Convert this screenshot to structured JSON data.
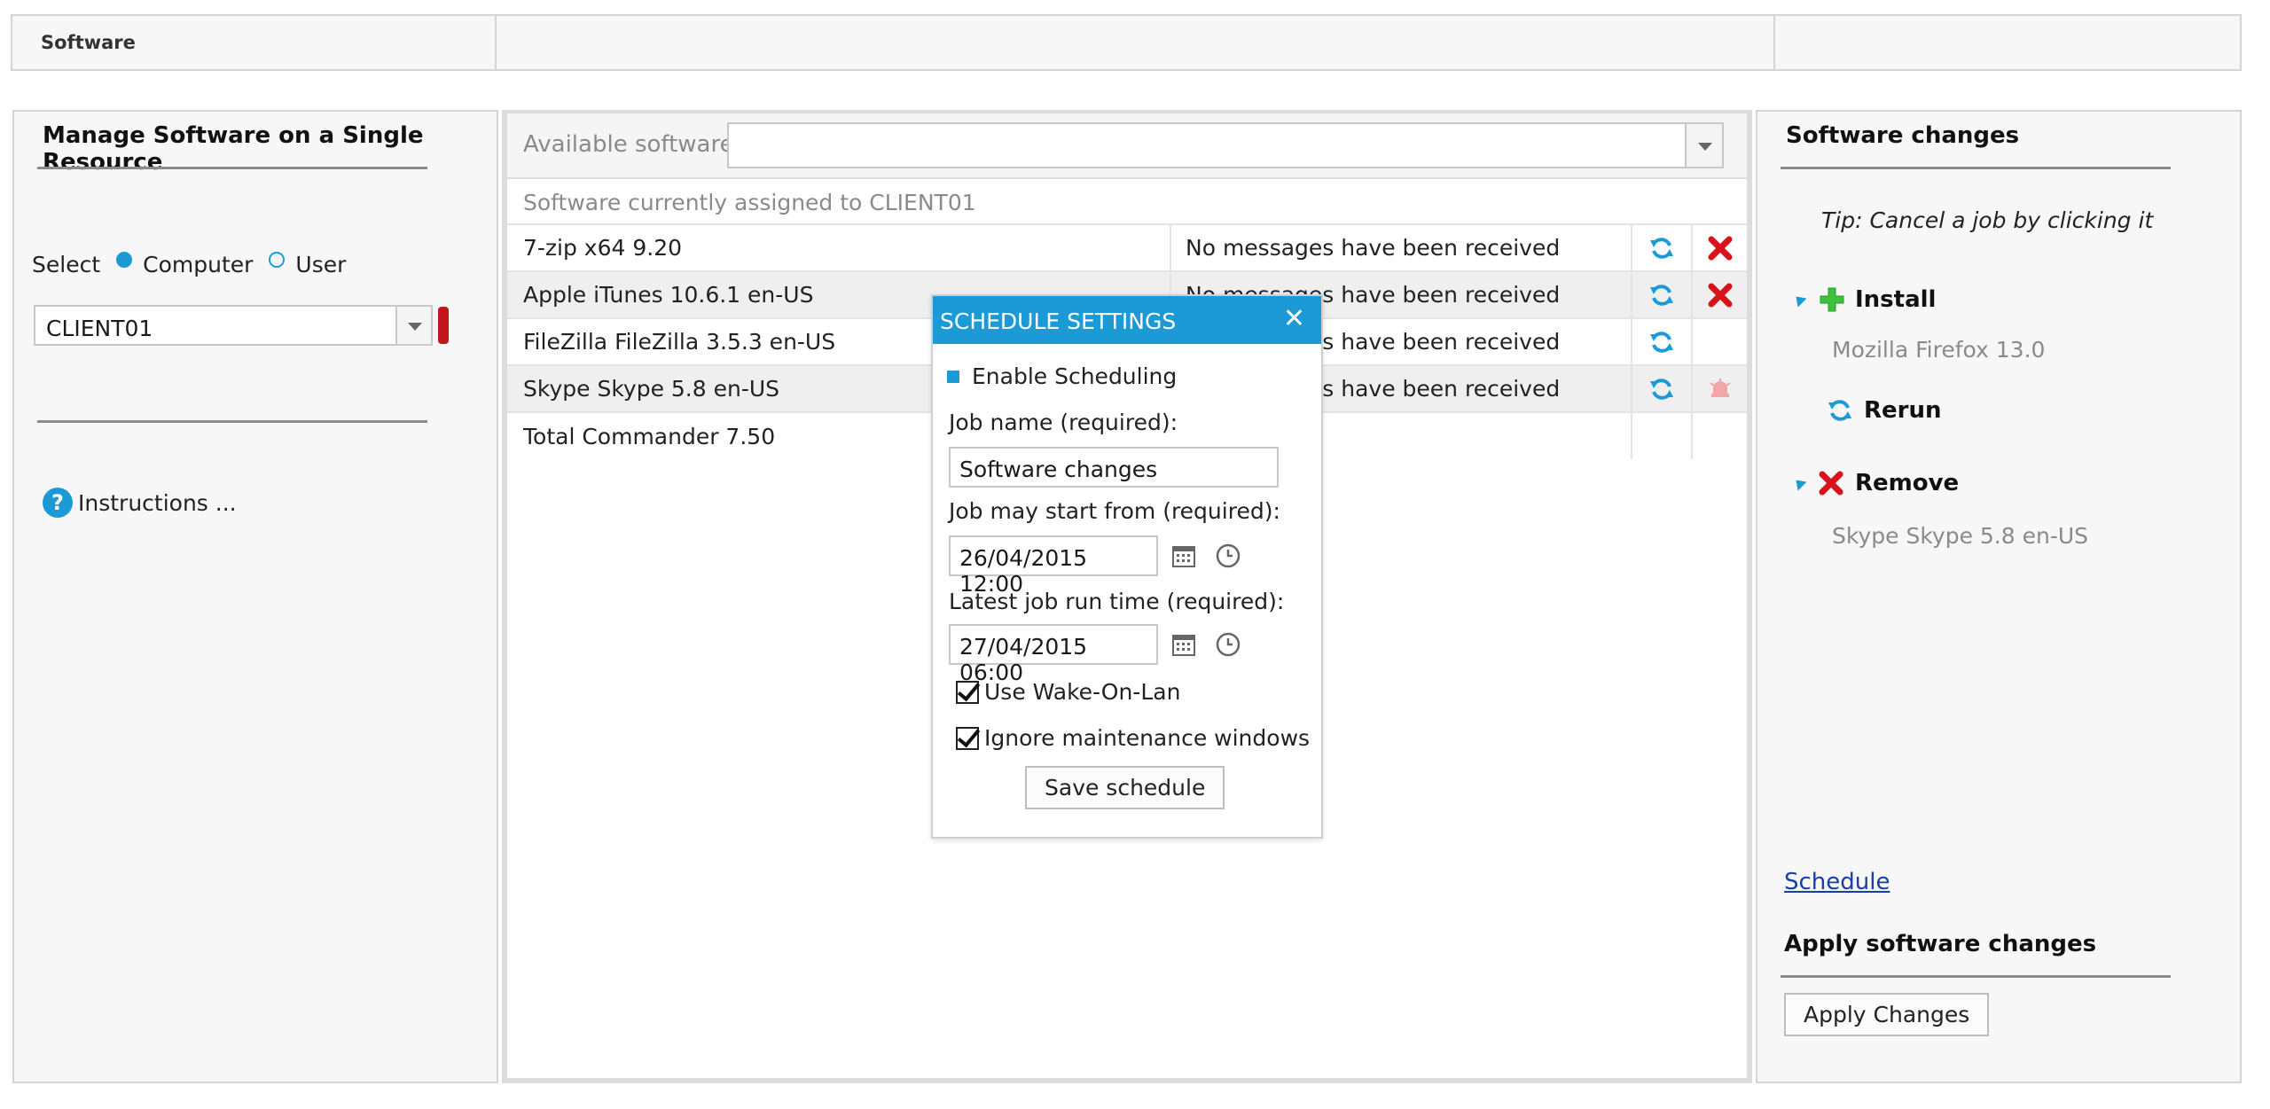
{
  "header": {
    "title": "Software"
  },
  "left": {
    "heading": "Manage Software on a Single Resource",
    "select_label": "Select",
    "radio_computer": "Computer",
    "radio_user": "User",
    "resource_value": "CLIENT01",
    "instructions": "Instructions ..."
  },
  "middle": {
    "available_label": "Available software",
    "assigned_label": "Software currently assigned to CLIENT01",
    "rows": [
      {
        "name": "7-zip x64 9.20",
        "message": "No messages have been received"
      },
      {
        "name": "Apple iTunes 10.6.1 en-US",
        "message": "No messages have been received"
      },
      {
        "name": "FileZilla FileZilla 3.5.3 en-US",
        "message": "No messages have been received"
      },
      {
        "name": "Skype Skype 5.8 en-US",
        "message": "No messages have been received"
      },
      {
        "name": "Total Commander 7.50",
        "message": ""
      }
    ]
  },
  "dialog": {
    "title": "SCHEDULE SETTINGS",
    "enable_label": "Enable Scheduling",
    "job_name_label": "Job name (required):",
    "job_name_value": "Software changes",
    "start_label": "Job may start from (required):",
    "start_value": "26/04/2015 12:00",
    "latest_label": "Latest job run time (required):",
    "latest_value": "27/04/2015 06:00",
    "wol_label": "Use Wake-On-Lan",
    "maint_label": "Ignore maintenance windows",
    "save_label": "Save schedule"
  },
  "right": {
    "heading": "Software changes",
    "tip": "Tip: Cancel a job by clicking it",
    "install_label": "Install",
    "install_item": "Mozilla Firefox 13.0",
    "rerun_label": "Rerun",
    "remove_label": "Remove",
    "remove_item": "Skype Skype 5.8 en-US",
    "schedule_link": "Schedule",
    "apply_heading": "Apply software changes",
    "apply_button": "Apply Changes"
  },
  "colors": {
    "accent": "#1b9ad6",
    "danger": "#d7141a",
    "install": "#3cc13c"
  }
}
